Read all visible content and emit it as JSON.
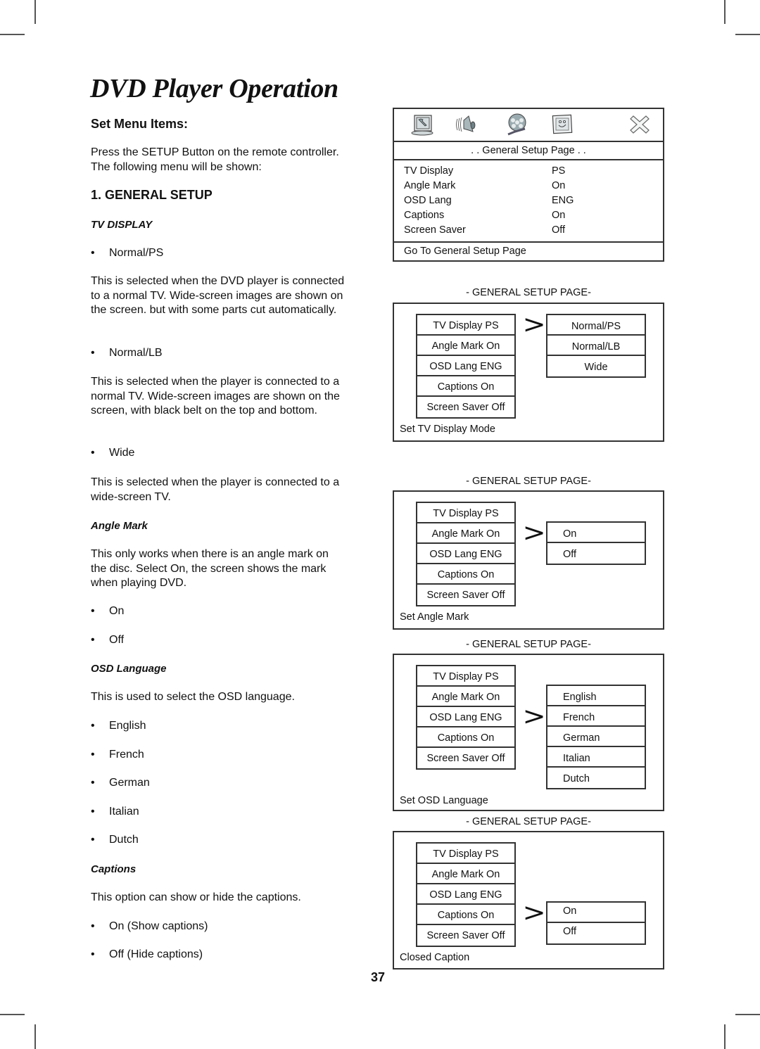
{
  "document": {
    "title": "DVD Player Operation",
    "page_number": "37"
  },
  "left": {
    "section_heading": "Set Menu Items:",
    "intro": "Press the SETUP Button on the remote controller. The following menu will be shown:",
    "general_setup_heading": "1. GENERAL SETUP",
    "tv_display": {
      "heading": "TV DISPLAY",
      "items": [
        {
          "bullet": "Normal/PS",
          "desc": "This is selected when the DVD player is connected to a normal TV. Wide-screen images are shown on the screen. but with some parts cut automatically."
        },
        {
          "bullet": "Normal/LB",
          "desc": "This is selected when the player is connected to a normal TV. Wide-screen images are shown on the screen, with black belt on the top and bottom."
        },
        {
          "bullet": "Wide",
          "desc": "This is selected when the player is connected to a wide-screen TV."
        }
      ]
    },
    "angle_mark": {
      "heading": "Angle Mark",
      "desc": "This only works when there is an angle mark on the disc. Select On, the screen shows the mark when playing DVD.",
      "bullets": [
        "On",
        "Off"
      ]
    },
    "osd_language": {
      "heading": "OSD Language",
      "desc": "This is used to select the OSD language.",
      "bullets": [
        "English",
        "French",
        "German",
        "Italian",
        "Dutch"
      ]
    },
    "captions": {
      "heading": "Captions",
      "desc": "This option can show or hide the captions.",
      "bullets": [
        "On (Show captions)",
        "Off (Hide captions)"
      ]
    },
    "bullet_glyph": "•"
  },
  "osd_main": {
    "icons": [
      "general-setup-icon",
      "audio-setup-icon",
      "video-setup-icon",
      "preference-setup-icon",
      "exit-icon"
    ],
    "page_title": ". .  General Setup Page . .",
    "rows": [
      {
        "label": "TV Display",
        "value": "PS"
      },
      {
        "label": "Angle Mark",
        "value": "On"
      },
      {
        "label": "OSD Lang",
        "value": "ENG"
      },
      {
        "label": "Captions",
        "value": "On"
      },
      {
        "label": "Screen Saver",
        "value": "Off"
      }
    ],
    "footer": "Go To General Setup Page"
  },
  "panels": [
    {
      "caption": "- GENERAL SETUP PAGE-",
      "menu": [
        "TV  Display PS",
        "Angle Mark On",
        "OSD Lang ENG",
        "Captions On",
        "Screen  Saver Off"
      ],
      "arrow": ">",
      "options": [
        "Normal/PS",
        "Normal/LB",
        "Wide"
      ],
      "footer": "Set TV Display  Mode"
    },
    {
      "caption": "- GENERAL SETUP PAGE-",
      "menu": [
        "TV Display  PS",
        "Angle Mark On",
        "OSD Lang ENG",
        "Captions On",
        "Screen  Saver Off"
      ],
      "arrow": ">",
      "options": [
        "On",
        "Off"
      ],
      "footer": "Set Angle Mark"
    },
    {
      "caption": "- GENERAL SETUP PAGE-",
      "menu": [
        "TV Display PS",
        "Angle  Mark On",
        "OSD Lang ENG",
        "Captions On",
        "Screen  Saver Off"
      ],
      "arrow": ">",
      "options": [
        "English",
        "French",
        "German",
        "Italian",
        "Dutch"
      ],
      "footer": "Set OSD Language"
    },
    {
      "caption": "- GENERAL SETUP PAGE-",
      "menu": [
        "TV Display PS",
        "Angle Mark On",
        "OSD Lang ENG",
        "Captions On",
        "Screen  Saver Off"
      ],
      "arrow": ">",
      "options": [
        "On",
        "Off"
      ],
      "footer": "Closed Caption"
    }
  ]
}
